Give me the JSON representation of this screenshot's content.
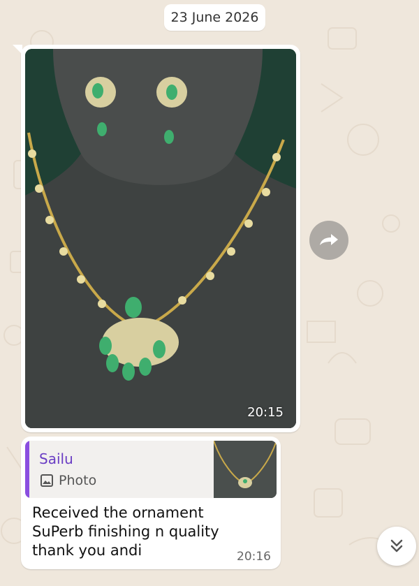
{
  "date_divider": "23 June 2026",
  "image_message": {
    "time": "20:15"
  },
  "reply_message": {
    "quoted": {
      "sender": "Sailu",
      "type_label": "Photo"
    },
    "text": "Received the ornament\nSuPerb finishing n quality\nthank you andi",
    "time": "20:16"
  },
  "colors": {
    "chat_background": "#efe7dc",
    "bubble": "#ffffff",
    "quote_accent": "#8a4ee0",
    "quote_sender": "#6a3dc4"
  },
  "icons": {
    "forward": "forward-icon",
    "photo": "photo-icon",
    "scroll_down": "double-chevron-down-icon"
  }
}
